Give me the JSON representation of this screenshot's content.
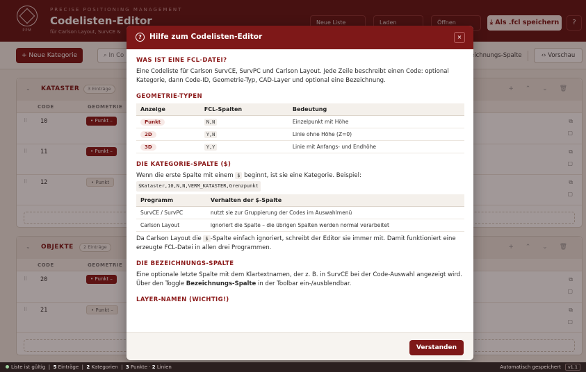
{
  "header": {
    "logo_text": "PPM",
    "tagline": "PRECISE POSITIONING MANAGEMENT",
    "title": "Codelisten-Editor",
    "subtitle": "für Carlson Layout, SurvCE &",
    "buttons": [
      "Neue Liste",
      "Laden",
      "Öffnen"
    ],
    "save_label": "Als .fcl speichern",
    "help_icon": "?"
  },
  "toolbar": {
    "new_category": "+ Neue Kategorie",
    "search_placeholder": "In Co",
    "bez_toggle": "eichnungs-Spalte",
    "preview": "‹› Vorschau"
  },
  "categories": [
    {
      "name": "KATASTER",
      "count": "3 Einträge",
      "actions": "+ ⌃ ⌄ 🗑",
      "rows": [
        {
          "code": "10",
          "geo": "• Punkt  –"
        },
        {
          "code": "11",
          "geo": "• Punkt  –"
        },
        {
          "code": "12",
          "geo": "• Punkt"
        }
      ]
    },
    {
      "name": "OBJEKTE",
      "count": "2 Einträge",
      "actions": "+ ⌃ ⌄ 🗑",
      "rows": [
        {
          "code": "20",
          "geo": "• Punkt  –"
        },
        {
          "code": "21",
          "geo": "• Punkt  –"
        }
      ]
    }
  ],
  "columns": {
    "code": "CODE",
    "geometrie": "GEOMETRIE"
  },
  "modal": {
    "title": "Hilfe zum Codelisten-Editor",
    "close": "×",
    "s1_title": "WAS IST EINE FCL-DATEI?",
    "s1_text": "Eine Codeliste für Carlson SurvCE, SurvPC und Carlson Layout. Jede Zeile beschreibt einen Code: optional Kategorie, dann Code-ID, Geometrie-Typ, CAD-Layer und optional eine Bezeichnung.",
    "s2_title": "GEOMETRIE-TYPEN",
    "geo_headers": [
      "Anzeige",
      "FCL-Spalten",
      "Bedeutung"
    ],
    "geo_rows": [
      [
        "Punkt",
        "N,N",
        "Einzelpunkt mit Höhe"
      ],
      [
        "2D",
        "Y,N",
        "Linie ohne Höhe (Z=0)"
      ],
      [
        "3D",
        "Y,Y",
        "Linie mit Anfangs- und Endhöhe"
      ]
    ],
    "s3_title": "DIE KATEGORIE-SPALTE ($)",
    "s3_text_a": "Wenn die erste Spalte mit einem",
    "s3_dollar": "$",
    "s3_text_b": "beginnt, ist sie eine Kategorie. Beispiel:",
    "s3_example": "$Kataster,10,N,N,VERM_KATASTER,Grenzpunkt",
    "prog_headers": [
      "Programm",
      "Verhalten der $-Spalte"
    ],
    "prog_rows": [
      [
        "SurvCE / SurvPC",
        "nutzt sie zur Gruppierung der Codes im Auswahlmenü"
      ],
      [
        "Carlson Layout",
        "ignoriert die Spalte – die übrigen Spalten werden normal verarbeitet"
      ]
    ],
    "s3_note_a": "Da Carlson Layout die",
    "s3_note_b": "-Spalte einfach ignoriert, schreibt der Editor sie immer mit. Damit funktioniert eine erzeugte FCL-Datei in allen drei Programmen.",
    "s4_title": "DIE BEZEICHNUNGS-SPALTE",
    "s4_text_a": "Eine optionale letzte Spalte mit dem Klartextnamen, der z. B. in SurvCE bei der Code-Auswahl angezeigt wird. Über den Toggle",
    "s4_bold": "Bezeichnungs-Spalte",
    "s4_text_b": "in der Toolbar ein-/ausblendbar.",
    "s5_title": "LAYER-NAMEN (WICHTIG!)",
    "ok": "Verstanden"
  },
  "status": {
    "valid": "Liste ist gültig",
    "entries": "5",
    "entries_label": "Einträge",
    "cats": "2",
    "cats_label": "Kategorien",
    "points": "3",
    "points_label": "Punkte",
    "lines": "2",
    "lines_label": "Linien",
    "autosave": "Automatisch gespeichert",
    "version": "v1.1"
  }
}
